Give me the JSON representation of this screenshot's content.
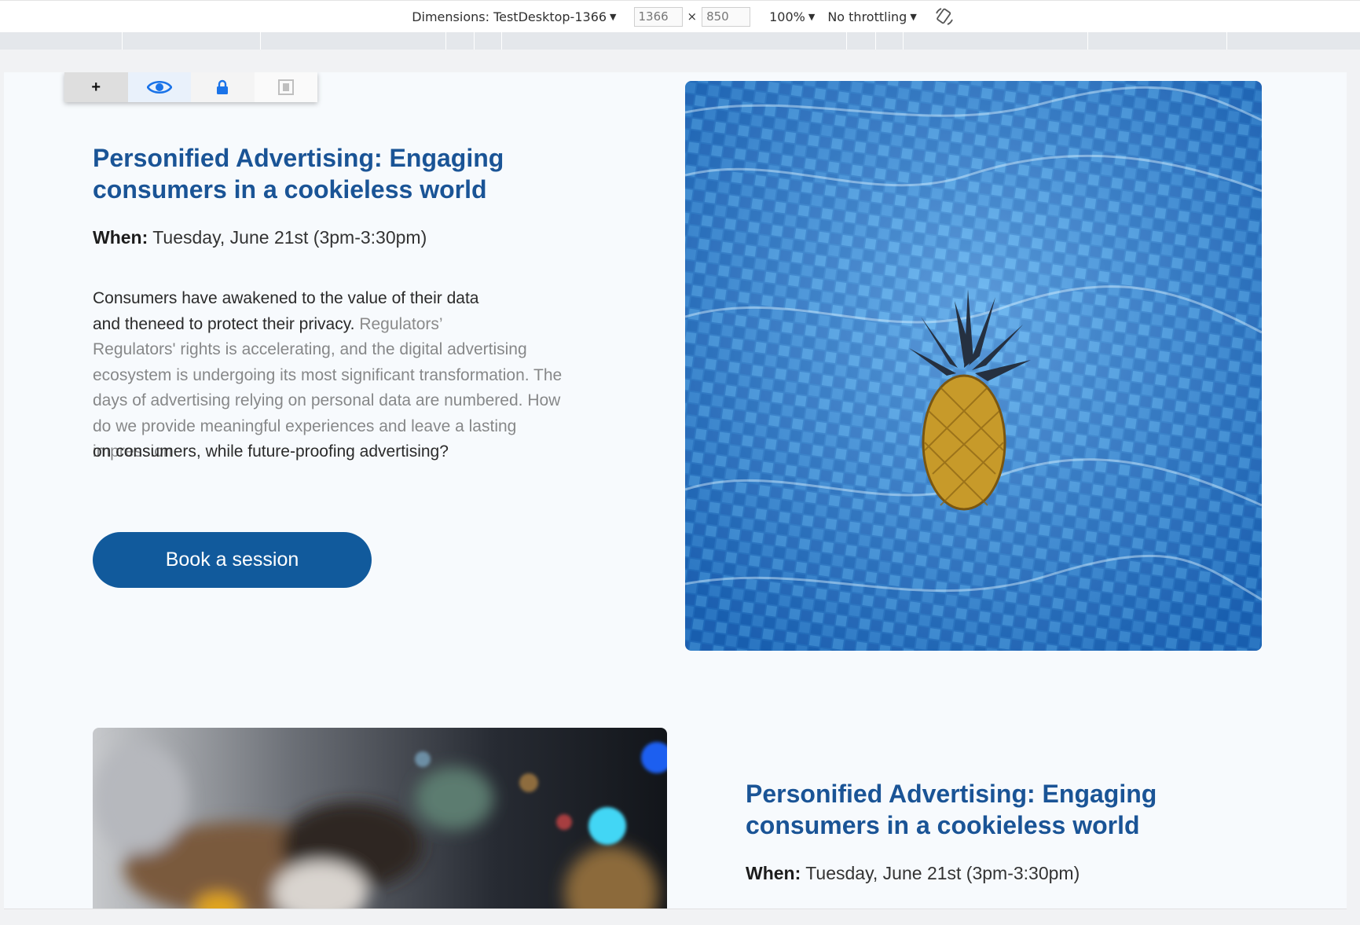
{
  "devtools": {
    "dimensions_label": "Dimensions: TestDesktop-1366",
    "width_value": "1366",
    "height_value": "850",
    "times": "×",
    "zoom": "100%",
    "throttling": "No throttling",
    "icons": [
      "chevron-down-icon",
      "rotate-icon"
    ]
  },
  "edit_toolbar": {
    "add_label": "+",
    "icons": [
      "plus-icon",
      "eye-icon",
      "lock-icon",
      "frame-icon"
    ]
  },
  "session1": {
    "title": "Personified Advertising: Engaging consumers in a cookieless world",
    "when_label": "When:",
    "when_value": " Tuesday, June 21st (3pm-3:30pm)",
    "desc_line1": "Consumers have awakened to the value of their data",
    "desc_line2": "and theneed to protect their privacy.",
    "desc_line2_fade": "Regulators’",
    "ghost_text": "Regulators' rights is accelerating, and the digital advertising ecosystem is undergoing its most significant transformation. The days of advertising relying on personal data are numbered. How do we provide meaningful experiences and leave a lasting impression",
    "desc_last_line": "on consumers, while future-proofing advertising?",
    "button_label": "Book a session",
    "image": "pineapple-floating-in-pool-image"
  },
  "session2": {
    "title": "Personified Advertising: Engaging consumers in a cookieless world",
    "when_label": "When:",
    "when_value": " Tuesday, June 21st (3pm-3:30pm)",
    "image": "blurred-bokeh-photo"
  },
  "colors": {
    "accent": "#115a9c",
    "title": "#1a5496",
    "page_bg": "#f7fafd"
  }
}
